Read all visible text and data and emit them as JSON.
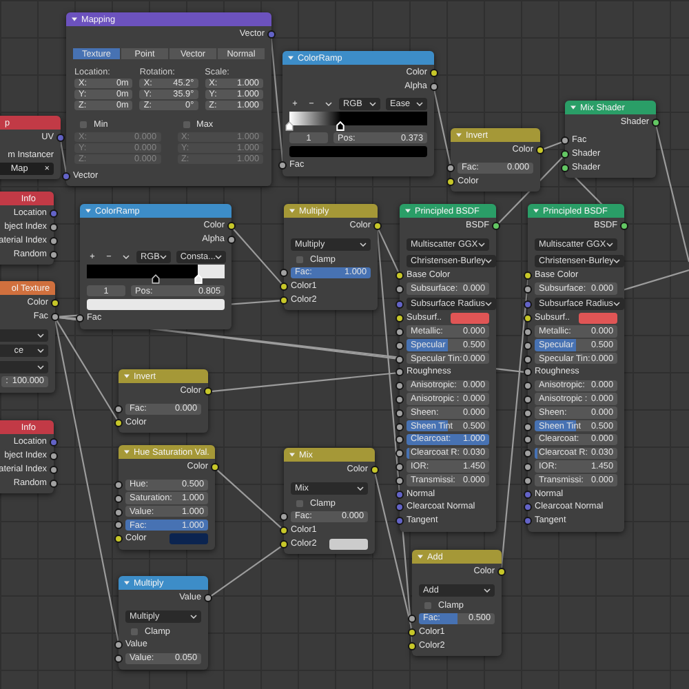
{
  "nodes": [
    {
      "title": "p",
      "color": "#c23a46",
      "rows": [
        {
          "kind": "output",
          "label": "UV",
          "socket": {
            "color": "#6363c7"
          }
        },
        {
          "kind": "label",
          "label": "m Instancer"
        },
        {
          "kind": "text-field",
          "value": "Map",
          "clear": "×"
        }
      ]
    },
    {
      "title": "Mapping",
      "color": "#6c52be",
      "rows": [
        {
          "kind": "output",
          "label": "Vector",
          "socket": {
            "color": "#6363c7"
          }
        },
        {
          "kind": "tabs",
          "tabs": [
            {
              "label": "Texture",
              "selected": true
            },
            {
              "label": "Point",
              "selected": false
            },
            {
              "label": "Vector",
              "selected": false
            },
            {
              "label": "Normal",
              "selected": false
            }
          ]
        },
        {
          "kind": "columns",
          "columns": [
            {
              "title": "Location:",
              "fields": [
                {
                  "label": "X:",
                  "value": "0m"
                },
                {
                  "label": "Y:",
                  "value": "0m"
                },
                {
                  "label": "Z:",
                  "value": "0m"
                }
              ]
            },
            {
              "title": "Rotation:",
              "fields": [
                {
                  "label": "X:",
                  "value": "45.2°"
                },
                {
                  "label": "Y:",
                  "value": "35.9°"
                },
                {
                  "label": "Z:",
                  "value": "0°"
                }
              ]
            },
            {
              "title": "Scale:",
              "fields": [
                {
                  "label": "X:",
                  "value": "1.000"
                },
                {
                  "label": "Y:",
                  "value": "1.000"
                },
                {
                  "label": "Z:",
                  "value": "1.000"
                }
              ]
            }
          ]
        },
        {
          "kind": "limits",
          "columns": [
            {
              "title": "Min",
              "checked": false,
              "fields": [
                {
                  "label": "X:",
                  "value": "0.000",
                  "disabled": true
                },
                {
                  "label": "Y:",
                  "value": "0.000",
                  "disabled": true
                },
                {
                  "label": "Z:",
                  "value": "0.000",
                  "disabled": true
                }
              ]
            },
            {
              "title": "Max",
              "checked": false,
              "fields": [
                {
                  "label": "X:",
                  "value": "1.000",
                  "disabled": true
                },
                {
                  "label": "Y:",
                  "value": "1.000",
                  "disabled": true
                },
                {
                  "label": "Z:",
                  "value": "1.000",
                  "disabled": true
                }
              ]
            }
          ]
        },
        {
          "kind": "input",
          "label": "Vector",
          "socket": {
            "color": "#6363c7"
          }
        }
      ]
    },
    {
      "title": "ColorRamp",
      "color": "#3d8dc8",
      "rows": [
        {
          "kind": "output",
          "label": "Color",
          "socket": {
            "color": "#c7c729"
          }
        },
        {
          "kind": "output",
          "label": "Alpha",
          "socket": {
            "color": "#a1a1a1"
          }
        },
        {
          "kind": "ramp-tools",
          "buttons": [
            "+",
            "−"
          ],
          "dropdowns": [
            "RGB",
            "Ease"
          ]
        },
        {
          "kind": "ramp",
          "constant": false,
          "stops": [
            {
              "color": "#ffffff",
              "level": 0,
              "selected": false
            },
            {
              "color": "#000000",
              "level": 0.373,
              "selected": true
            }
          ]
        },
        {
          "kind": "ramp-stop",
          "index": "1",
          "label": "Pos:",
          "value": "0.373"
        },
        {
          "kind": "swatch",
          "color": "#000000"
        },
        {
          "kind": "input",
          "label": "Fac",
          "socket": {
            "color": "#a1a1a1"
          }
        }
      ]
    },
    {
      "title": "Invert",
      "color": "#a59837",
      "rows": [
        {
          "kind": "output",
          "label": "Color",
          "socket": {
            "color": "#c7c729"
          }
        },
        {
          "kind": "field",
          "label": "Fac:",
          "value": "0.000",
          "socket": {
            "color": "#a1a1a1"
          }
        },
        {
          "kind": "input",
          "label": "Color",
          "socket": {
            "color": "#c7c729"
          }
        }
      ]
    },
    {
      "title": "Mix Shader",
      "color": "#2a9e67",
      "rows": [
        {
          "kind": "output",
          "label": "Shader",
          "socket": {
            "color": "#63c763"
          }
        },
        {
          "kind": "input",
          "label": "Fac",
          "socket": {
            "color": "#a1a1a1"
          }
        },
        {
          "kind": "input",
          "label": "Shader",
          "socket": {
            "color": "#63c763"
          }
        },
        {
          "kind": "input",
          "label": "Shader",
          "socket": {
            "color": "#63c763"
          }
        }
      ]
    },
    {
      "title": "Info",
      "color": "#c23a46",
      "rows": [
        {
          "kind": "output",
          "label": "Location",
          "socket": {
            "color": "#6363c7"
          }
        },
        {
          "kind": "output",
          "label": "bject Index",
          "socket": {
            "color": "#a1a1a1"
          }
        },
        {
          "kind": "output",
          "label": "aterial Index",
          "socket": {
            "color": "#a1a1a1"
          }
        },
        {
          "kind": "output",
          "label": "Random",
          "socket": {
            "color": "#a1a1a1"
          }
        }
      ]
    },
    {
      "title": "ol Texture",
      "color": "#d0703e",
      "rows": [
        {
          "kind": "output",
          "label": "Color",
          "socket": {
            "color": "#c7c729"
          }
        },
        {
          "kind": "output",
          "label": "Fac",
          "socket": {
            "color": "#a1a1a1"
          }
        },
        {
          "kind": "dropdown"
        },
        {
          "kind": "dropdown",
          "value": "ce"
        },
        {
          "kind": "dropdown"
        },
        {
          "kind": "field",
          "label": ":",
          "value": "100.000"
        }
      ]
    },
    {
      "title": "ColorRamp",
      "color": "#3d8dc8",
      "rows": [
        {
          "kind": "output",
          "label": "Color",
          "socket": {
            "color": "#c7c729"
          }
        },
        {
          "kind": "output",
          "label": "Alpha",
          "socket": {
            "color": "#a1a1a1"
          }
        },
        {
          "kind": "ramp-tools",
          "buttons": [
            "+",
            "−"
          ],
          "dropdowns": [
            "RGB",
            "Consta..."
          ]
        },
        {
          "kind": "ramp",
          "constant": true,
          "stops": [
            {
              "color": "#000000",
              "level": 0.5,
              "selected": false
            },
            {
              "color": "#e8e8e8",
              "level": 0.805,
              "selected": true
            }
          ]
        },
        {
          "kind": "ramp-stop",
          "index": "1",
          "label": "Pos:",
          "value": "0.805"
        },
        {
          "kind": "swatch",
          "color": "#e8e8e8"
        },
        {
          "kind": "input",
          "label": "Fac",
          "socket": {
            "color": "#a1a1a1"
          }
        }
      ]
    },
    {
      "title": "Invert",
      "color": "#a59837",
      "rows": [
        {
          "kind": "output",
          "label": "Color",
          "socket": {
            "color": "#c7c729"
          }
        },
        {
          "kind": "field",
          "label": "Fac:",
          "value": "0.000",
          "socket": {
            "color": "#a1a1a1"
          }
        },
        {
          "kind": "input",
          "label": "Color",
          "socket": {
            "color": "#c7c729"
          }
        }
      ]
    },
    {
      "title": "Multiply",
      "color": "#a59837",
      "rows": [
        {
          "kind": "output",
          "label": "Color",
          "socket": {
            "color": "#c7c729"
          }
        },
        {
          "kind": "dropdown",
          "value": "Multiply"
        },
        {
          "kind": "checkbox",
          "label": "Clamp",
          "checked": false
        },
        {
          "kind": "field",
          "label": "Fac:",
          "value": "1.000",
          "level": 1,
          "socket": {
            "color": "#a1a1a1"
          }
        },
        {
          "kind": "input",
          "label": "Color1",
          "socket": {
            "color": "#c7c729"
          }
        },
        {
          "kind": "input",
          "label": "Color2",
          "socket": {
            "color": "#c7c729"
          }
        }
      ]
    },
    {
      "title": "Principled BSDF",
      "color": "#2a9e67",
      "rows": [
        {
          "kind": "output",
          "label": "BSDF",
          "socket": {
            "color": "#63c763"
          }
        },
        {
          "kind": "dropdown",
          "value": "Multiscatter GGX"
        },
        {
          "kind": "dropdown",
          "value": "Christensen-Burley"
        },
        {
          "kind": "input",
          "label": "Base Color",
          "socket": {
            "color": "#c7c729"
          }
        },
        {
          "kind": "field",
          "label": "Subsurface:",
          "value": "0.000",
          "socket": {
            "color": "#a1a1a1"
          }
        },
        {
          "kind": "dropdown",
          "value": "Subsurface Radius",
          "socket": {
            "color": "#6363c7"
          }
        },
        {
          "kind": "swatch",
          "label": "Subsurf..",
          "color": "#e05555",
          "socket": {
            "color": "#c7c729"
          }
        },
        {
          "kind": "field",
          "label": "Metallic:",
          "value": "0.000",
          "socket": {
            "color": "#a1a1a1"
          }
        },
        {
          "kind": "field",
          "label": "Specular",
          "value": "0.500",
          "level": 0.5,
          "socket": {
            "color": "#a1a1a1"
          }
        },
        {
          "kind": "field",
          "label": "Specular Tin:",
          "value": "0.000",
          "socket": {
            "color": "#a1a1a1"
          }
        },
        {
          "kind": "input",
          "label": "Roughness",
          "socket": {
            "color": "#a1a1a1"
          }
        },
        {
          "kind": "field",
          "label": "Anisotropic:",
          "value": "0.000",
          "socket": {
            "color": "#a1a1a1"
          }
        },
        {
          "kind": "field",
          "label": "Anisotropic :",
          "value": "0.000",
          "socket": {
            "color": "#a1a1a1"
          }
        },
        {
          "kind": "field",
          "label": "Sheen:",
          "value": "0.000",
          "socket": {
            "color": "#a1a1a1"
          }
        },
        {
          "kind": "field",
          "label": "Sheen Tint",
          "value": "0.500",
          "level": 0.5,
          "socket": {
            "color": "#a1a1a1"
          }
        },
        {
          "kind": "field",
          "label": "Clearcoat:",
          "value": "1.000",
          "level": 1,
          "socket": {
            "color": "#a1a1a1"
          }
        },
        {
          "kind": "field",
          "label": "Clearcoat R:",
          "value": "0.030",
          "level": 0.03,
          "socket": {
            "color": "#a1a1a1"
          }
        },
        {
          "kind": "field",
          "label": "IOR:",
          "value": "1.450",
          "socket": {
            "color": "#a1a1a1"
          }
        },
        {
          "kind": "field",
          "label": "Transmissi:",
          "value": "0.000",
          "socket": {
            "color": "#a1a1a1"
          }
        },
        {
          "kind": "input",
          "label": "Normal",
          "socket": {
            "color": "#6363c7"
          }
        },
        {
          "kind": "input",
          "label": "Clearcoat Normal",
          "socket": {
            "color": "#6363c7"
          }
        },
        {
          "kind": "input",
          "label": "Tangent",
          "socket": {
            "color": "#6363c7"
          }
        }
      ]
    },
    {
      "title": "Principled BSDF",
      "color": "#2a9e67",
      "rows": [
        {
          "kind": "output",
          "label": "BSDF",
          "socket": {
            "color": "#63c763"
          }
        },
        {
          "kind": "dropdown",
          "value": "Multiscatter GGX"
        },
        {
          "kind": "dropdown",
          "value": "Christensen-Burley"
        },
        {
          "kind": "input",
          "label": "Base Color",
          "socket": {
            "color": "#c7c729"
          }
        },
        {
          "kind": "field",
          "label": "Subsurface:",
          "value": "0.000",
          "socket": {
            "color": "#a1a1a1"
          }
        },
        {
          "kind": "dropdown",
          "value": "Subsurface Radius",
          "socket": {
            "color": "#6363c7"
          }
        },
        {
          "kind": "swatch",
          "label": "Subsurf..",
          "color": "#e05555",
          "socket": {
            "color": "#c7c729"
          }
        },
        {
          "kind": "field",
          "label": "Metallic:",
          "value": "0.000",
          "socket": {
            "color": "#a1a1a1"
          }
        },
        {
          "kind": "field",
          "label": "Specular",
          "value": "0.500",
          "level": 0.5,
          "socket": {
            "color": "#a1a1a1"
          }
        },
        {
          "kind": "field",
          "label": "Specular Tin:",
          "value": "0.000",
          "socket": {
            "color": "#a1a1a1"
          }
        },
        {
          "kind": "input",
          "label": "Roughness",
          "socket": {
            "color": "#a1a1a1"
          }
        },
        {
          "kind": "field",
          "label": "Anisotropic:",
          "value": "0.000",
          "socket": {
            "color": "#a1a1a1"
          }
        },
        {
          "kind": "field",
          "label": "Anisotropic :",
          "value": "0.000",
          "socket": {
            "color": "#a1a1a1"
          }
        },
        {
          "kind": "field",
          "label": "Sheen:",
          "value": "0.000",
          "socket": {
            "color": "#a1a1a1"
          }
        },
        {
          "kind": "field",
          "label": "Sheen Tint",
          "value": "0.500",
          "level": 0.5,
          "socket": {
            "color": "#a1a1a1"
          }
        },
        {
          "kind": "field",
          "label": "Clearcoat:",
          "value": "0.000",
          "socket": {
            "color": "#a1a1a1"
          }
        },
        {
          "kind": "field",
          "label": "Clearcoat R:",
          "value": "0.030",
          "level": 0.03,
          "socket": {
            "color": "#a1a1a1"
          }
        },
        {
          "kind": "field",
          "label": "IOR:",
          "value": "1.450",
          "socket": {
            "color": "#a1a1a1"
          }
        },
        {
          "kind": "field",
          "label": "Transmissi:",
          "value": "0.000",
          "socket": {
            "color": "#a1a1a1"
          }
        },
        {
          "kind": "input",
          "label": "Normal",
          "socket": {
            "color": "#6363c7"
          }
        },
        {
          "kind": "input",
          "label": "Clearcoat Normal",
          "socket": {
            "color": "#6363c7"
          }
        },
        {
          "kind": "input",
          "label": "Tangent",
          "socket": {
            "color": "#6363c7"
          }
        }
      ]
    },
    {
      "title": "Info",
      "color": "#c23a46",
      "rows": [
        {
          "kind": "output",
          "label": "Location",
          "socket": {
            "color": "#6363c7"
          }
        },
        {
          "kind": "output",
          "label": "bject Index",
          "socket": {
            "color": "#a1a1a1"
          }
        },
        {
          "kind": "output",
          "label": "aterial Index",
          "socket": {
            "color": "#a1a1a1"
          }
        },
        {
          "kind": "output",
          "label": "Random",
          "socket": {
            "color": "#a1a1a1"
          }
        }
      ]
    },
    {
      "title": "Hue Saturation Val.",
      "color": "#a59837",
      "rows": [
        {
          "kind": "output",
          "label": "Color",
          "socket": {
            "color": "#c7c729"
          }
        },
        {
          "kind": "field",
          "label": "Hue:",
          "value": "0.500",
          "socket": {
            "color": "#a1a1a1"
          }
        },
        {
          "kind": "field",
          "label": "Saturation:",
          "value": "1.000",
          "socket": {
            "color": "#a1a1a1"
          }
        },
        {
          "kind": "field",
          "label": "Value:",
          "value": "1.000",
          "socket": {
            "color": "#a1a1a1"
          }
        },
        {
          "kind": "field",
          "label": "Fac:",
          "value": "1.000",
          "level": 1,
          "socket": {
            "color": "#a1a1a1"
          }
        },
        {
          "kind": "swatch",
          "label": "Color",
          "color": "#0b2450",
          "socket": {
            "color": "#c7c729"
          }
        }
      ]
    },
    {
      "title": "Multiply",
      "color": "#3d8dc8",
      "rows": [
        {
          "kind": "output",
          "label": "Value",
          "socket": {
            "color": "#a1a1a1"
          }
        },
        {
          "kind": "dropdown",
          "value": "Multiply"
        },
        {
          "kind": "checkbox",
          "label": "Clamp",
          "checked": false
        },
        {
          "kind": "input",
          "label": "Value",
          "socket": {
            "color": "#a1a1a1"
          }
        },
        {
          "kind": "field",
          "label": "Value:",
          "value": "0.050",
          "socket": {
            "color": "#a1a1a1"
          }
        }
      ]
    },
    {
      "title": "Mix",
      "color": "#a59837",
      "rows": [
        {
          "kind": "output",
          "label": "Color",
          "socket": {
            "color": "#c7c729"
          }
        },
        {
          "kind": "dropdown",
          "value": "Mix"
        },
        {
          "kind": "checkbox",
          "label": "Clamp",
          "checked": false
        },
        {
          "kind": "field",
          "label": "Fac:",
          "value": "0.000",
          "socket": {
            "color": "#a1a1a1"
          }
        },
        {
          "kind": "input",
          "label": "Color1",
          "socket": {
            "color": "#c7c729"
          }
        },
        {
          "kind": "swatch",
          "label": "Color2",
          "color": "#cccccc",
          "socket": {
            "color": "#c7c729"
          }
        }
      ]
    },
    {
      "title": "Add",
      "color": "#a59837",
      "rows": [
        {
          "kind": "output",
          "label": "Color",
          "socket": {
            "color": "#c7c729"
          }
        },
        {
          "kind": "dropdown",
          "value": "Add"
        },
        {
          "kind": "checkbox",
          "label": "Clamp",
          "checked": false
        },
        {
          "kind": "field",
          "label": "Fac:",
          "value": "0.500",
          "level": 0.5,
          "socket": {
            "color": "#a1a1a1"
          }
        },
        {
          "kind": "input",
          "label": "Color1",
          "socket": {
            "color": "#c7c729"
          }
        },
        {
          "kind": "input",
          "label": "Color2",
          "socket": {
            "color": "#c7c729"
          }
        }
      ]
    }
  ]
}
